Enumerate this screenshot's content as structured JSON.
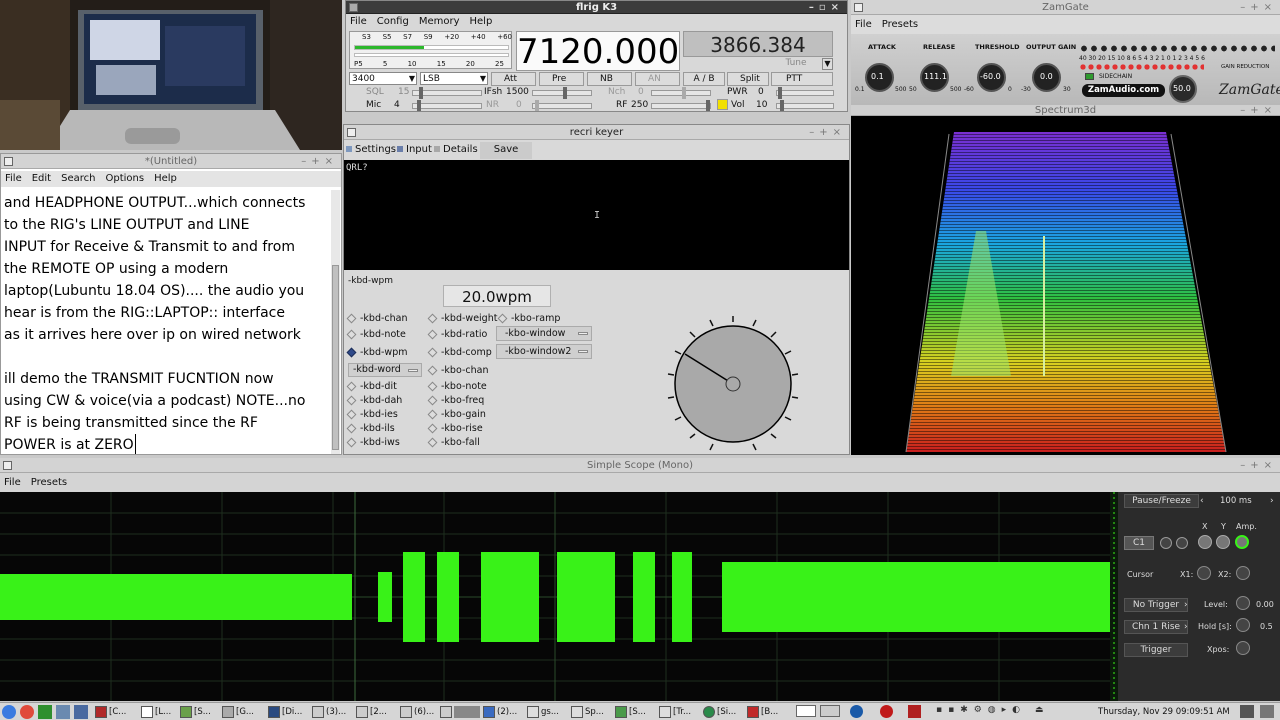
{
  "webcam": {
    "label": "webcam-feed"
  },
  "editor": {
    "title": "*(Untitled)",
    "menu": [
      "File",
      "Edit",
      "Search",
      "Options",
      "Help"
    ],
    "lines": [
      "and HEADPHONE OUTPUT...which connects",
      "to the RIG's LINE OUTPUT and LINE",
      "INPUT for Receive & Transmit to and from",
      "the REMOTE OP using a modern",
      "laptop(Lubuntu 18.04 OS).... the audio you",
      "hear is from the RIG::LAPTOP:: interface",
      "as it arrives here over ip on wired network",
      "",
      "ill demo the TRANSMIT FUCNTION now",
      "using CW & voice(via a podcast)  NOTE...no",
      "RF is being transmitted since the RF",
      "POWER is at ZERO"
    ]
  },
  "flrig": {
    "title": "flrig K3",
    "menu": [
      "File",
      "Config",
      "Memory",
      "Help"
    ],
    "freq_a": "7120.000",
    "freq_b": "3866.384",
    "smeter_top": [
      "S3",
      "S5",
      "S7",
      "S9",
      "+20",
      "+40",
      "+60"
    ],
    "smeter_bot": [
      "P5",
      "5",
      "10",
      "15",
      "20",
      "25"
    ],
    "bandwidth": "3400",
    "mode": "LSB",
    "buttons": [
      "Att",
      "Pre",
      "NB",
      "AN",
      "A / B",
      "Split",
      "PTT"
    ],
    "tune": "Tune",
    "sql_label": "SQL",
    "sql_val": "15",
    "mic_label": "Mic",
    "mic_val": "4",
    "ifsh_label": "IFsh",
    "ifsh_val": "1500",
    "nr_label": "NR",
    "nr_val": "0",
    "nch_label": "Nch",
    "nch_val": "0",
    "pwr_label": "PWR",
    "pwr_val": "0",
    "rf_label": "RF",
    "rf_val": "250",
    "vol_label": "Vol",
    "vol_val": "10"
  },
  "zamgate": {
    "title": "ZamGate",
    "menu": [
      "File",
      "Presets"
    ],
    "knobs": [
      {
        "label": "ATTACK",
        "val": "0.1",
        "min": "0.1",
        "max": "500"
      },
      {
        "label": "RELEASE",
        "val": "111.1",
        "min": "50",
        "max": "500"
      },
      {
        "label": "THRESHOLD",
        "val": "-60.0",
        "min": "-60",
        "max": "0"
      },
      {
        "label": "OUTPUT GAIN",
        "val": "0.0",
        "min": "-30",
        "max": "30"
      }
    ],
    "meter_scale": "40 30 20 15 10 8 6 5 4 3 2 1 0 1 2 3 4 5 6",
    "gain_reduction": "GAIN REDUCTION",
    "sidechain": "SIDECHAIN",
    "site": "ZamAudio.com",
    "logo": "ZamGate",
    "big_knob": "50.0"
  },
  "spectrum": {
    "title": "Spectrum3d"
  },
  "keyer": {
    "title": "recri keyer",
    "tabs": [
      "Settings",
      "Input",
      "Details"
    ],
    "save": "Save",
    "text": "QRL?",
    "group": "-kbd-wpm",
    "wpm": "20.0wpm",
    "col1": [
      "-kbd-chan",
      "-kbd-note",
      "-kbd-wpm",
      "-kbd-dit",
      "-kbd-dah",
      "-kbd-ies",
      "-kbd-ils",
      "-kbd-iws"
    ],
    "col2": [
      "-kbd-weight",
      "-kbd-ratio",
      "-kbd-comp",
      "-kbo-chan",
      "-kbo-note",
      "-kbo-freq",
      "-kbo-gain",
      "-kbo-rise",
      "-kbo-fall"
    ],
    "kbo_ramp": "-kbo-ramp",
    "kbo_window": "-kbo-window",
    "kbo_window2": "-kbo-window2",
    "kbd_word": "-kbd-word"
  },
  "scope": {
    "title": "Simple Scope (Mono)",
    "menu": [
      "File",
      "Presets"
    ],
    "pause": "Pause/Freeze",
    "time": "100 ms",
    "x": "X",
    "y": "Y",
    "amp": "Amp.",
    "c1": "C1",
    "cursor": "Cursor",
    "x1": "X1:",
    "x2": "X2:",
    "trigger_mode": "No Trigger",
    "level": "Level:",
    "level_val": "0.00",
    "chn": "Chn 1 Rise",
    "hold": "Hold [s]:",
    "hold_val": "0.5",
    "trigger": "Trigger",
    "xpos": "Xpos:"
  },
  "taskbar": {
    "items": [
      "[C...",
      "[L...",
      "[S...",
      "[G...",
      "[Di...",
      "(3)...",
      "[2...",
      "(6)...",
      "",
      "(2)...",
      "gs...",
      "Sp...",
      "[S...",
      "[Tr...",
      "[Si...",
      "[B..."
    ],
    "clock": "Thursday, Nov 29 09:09:51 AM"
  }
}
